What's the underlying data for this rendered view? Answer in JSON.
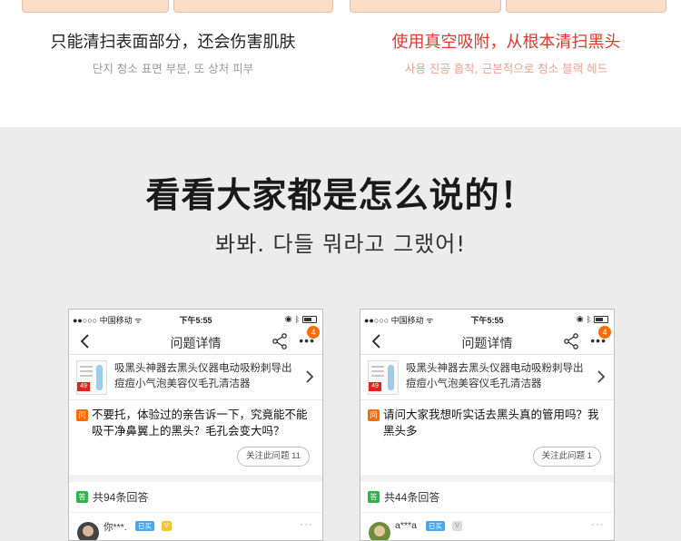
{
  "compare": {
    "left": {
      "zh": "只能清扫表面部分，还会伤害肌肤",
      "ko": "단지 청소 표면 부분, 또 상처 피부"
    },
    "right": {
      "zh": "使用真空吸附，从根本清扫黑头",
      "ko": "사용 진공 흡착, 근본적으로 청소 블랙 헤드"
    }
  },
  "reviews": {
    "headline": "看看大家都是怎么说的！",
    "subline": "봐봐. 다들 뭐라고 그랬어!"
  },
  "phones": [
    {
      "carrier": "●●○○○ 中国移动 ᯤ",
      "time": "下午5:55",
      "badge": "4",
      "nav_title": "问题详情",
      "product_title": "吸黑头神器去黑头仪器电动吸粉刺导出痘痘小气泡美容仪毛孔清洁器",
      "price_tag": "49",
      "question_tag": "问",
      "question": "不要托，体验过的亲告诉一下，究竟能不能吸干净鼻翼上的黑头？毛孔会变大吗？",
      "follow": "关注此问题 11",
      "answer_tag": "答",
      "answer_count": "共94条回答",
      "reply_user": "你***.",
      "reply_badge": "已买",
      "vip": "V"
    },
    {
      "carrier": "●●○○○ 中国移动 ᯤ",
      "time": "下午5:55",
      "badge": "4",
      "nav_title": "问题详情",
      "product_title": "吸黑头神器去黑头仪器电动吸粉刺导出痘痘小气泡美容仪毛孔清洁器",
      "price_tag": "49",
      "question_tag": "问",
      "question": "请问大家我想听实话去黑头真的管用吗？我黑头多",
      "follow": "关注此问题 1",
      "answer_tag": "答",
      "answer_count": "共44条回答",
      "reply_user": "a***a",
      "reply_badge": "已买",
      "vip": "V"
    }
  ]
}
